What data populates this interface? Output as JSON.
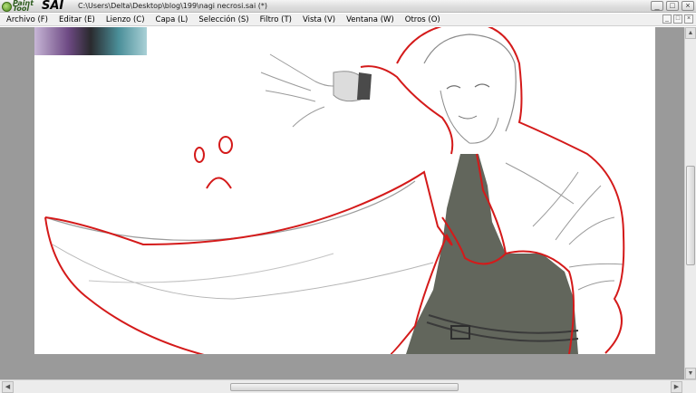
{
  "titlebar": {
    "logo_paint_top": "Paint",
    "logo_paint_bottom": "Tool",
    "logo_sai": "SAI",
    "path": "C:\\Users\\Delta\\Desktop\\blog\\199\\nagi necrosi.sai (*)",
    "window_controls": [
      "_",
      "□",
      "×"
    ]
  },
  "menu": {
    "items": [
      "Archivo (F)",
      "Editar (E)",
      "Lienzo (C)",
      "Capa (L)",
      "Selección (S)",
      "Filtro (T)",
      "Vista (V)",
      "Ventana (W)",
      "Otros (O)"
    ],
    "doc_controls": [
      "_",
      "□",
      "×"
    ]
  },
  "colors": {
    "workspace_bg": "#9a9a9a",
    "canvas_bg": "#ffffff",
    "red_annotation": "#d41a1a",
    "robe_fill": "#62665c",
    "lineart": "#8c8c8c"
  },
  "scrollbars": {
    "up_arrow": "▲",
    "down_arrow": "▼",
    "left_arrow": "◀",
    "right_arrow": "▶"
  }
}
